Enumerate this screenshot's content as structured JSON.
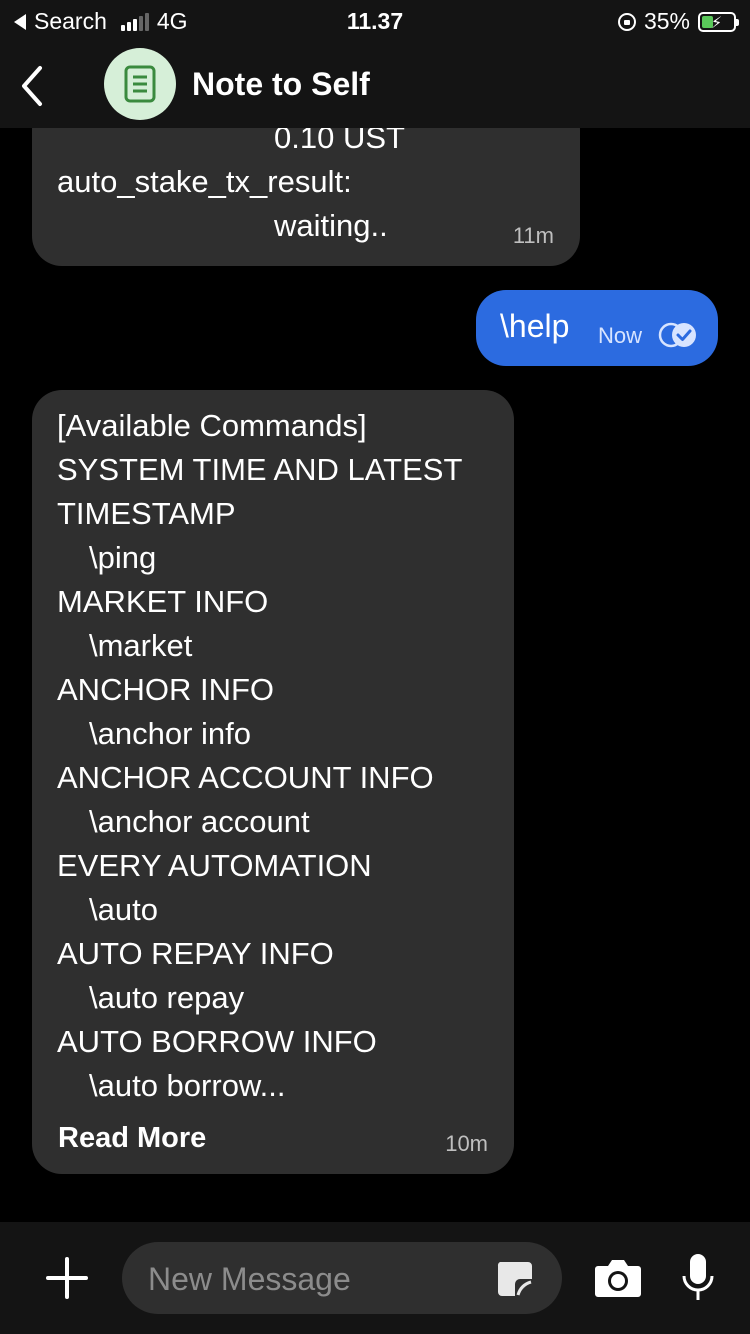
{
  "status_bar": {
    "back_label": "Search",
    "network": "4G",
    "time": "11.37",
    "battery_percent": "35%",
    "battery_level": 0.35
  },
  "header": {
    "title": "Note to Self"
  },
  "messages": [
    {
      "direction": "incoming",
      "lines": [
        "0.10 UST",
        "auto_stake_tx_result:",
        "waiting.."
      ],
      "time": "11m"
    },
    {
      "direction": "outgoing",
      "text": "\\help",
      "time": "Now"
    },
    {
      "direction": "incoming",
      "lines": [
        "[Available Commands]",
        "SYSTEM TIME AND LATEST",
        "TIMESTAMP",
        "\\ping",
        "MARKET INFO",
        "\\market",
        "ANCHOR INFO",
        "\\anchor info",
        "ANCHOR ACCOUNT INFO",
        "\\anchor account",
        "EVERY AUTOMATION",
        "\\auto",
        "AUTO REPAY INFO",
        "\\auto repay",
        "AUTO BORROW INFO",
        "\\auto borrow..."
      ],
      "read_more": "Read More",
      "time": "10m"
    }
  ],
  "composer": {
    "placeholder": "New Message"
  },
  "colors": {
    "background": "#000000",
    "incoming_bubble": "#2f2f2f",
    "outgoing_bubble": "#2c6be0",
    "avatar_bg": "#d6efd8",
    "avatar_icon": "#3a8a3e"
  },
  "icons": [
    "back-arrow-icon",
    "note-icon",
    "read-receipt-icon",
    "plus-icon",
    "sticker-icon",
    "camera-icon",
    "microphone-icon"
  ]
}
